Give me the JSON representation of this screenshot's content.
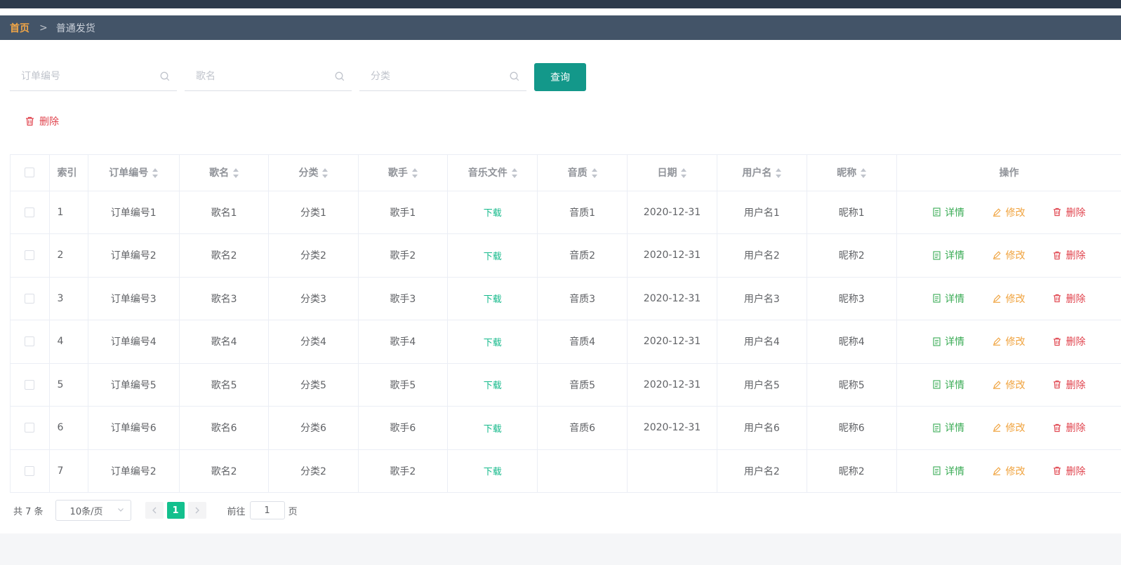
{
  "breadcrumb": {
    "home": "首页",
    "separator": ">",
    "current": "普通发货"
  },
  "search": {
    "order_placeholder": "订单编号",
    "song_placeholder": "歌名",
    "category_placeholder": "分类",
    "query_label": "查询"
  },
  "bulk_delete_label": "删除",
  "table": {
    "headers": {
      "index": "索引",
      "order": "订单编号",
      "song": "歌名",
      "category": "分类",
      "singer": "歌手",
      "file": "音乐文件",
      "quality": "音质",
      "date": "日期",
      "username": "用户名",
      "nickname": "昵称",
      "ops": "操作"
    },
    "actions": {
      "detail": "详情",
      "edit": "修改",
      "delete": "删除"
    },
    "rows": [
      {
        "index": "1",
        "order": "订单编号1",
        "song": "歌名1",
        "category": "分类1",
        "singer": "歌手1",
        "file": "下载",
        "quality": "音质1",
        "date": "2020-12-31",
        "username": "用户名1",
        "nickname": "昵称1"
      },
      {
        "index": "2",
        "order": "订单编号2",
        "song": "歌名2",
        "category": "分类2",
        "singer": "歌手2",
        "file": "下载",
        "quality": "音质2",
        "date": "2020-12-31",
        "username": "用户名2",
        "nickname": "昵称2"
      },
      {
        "index": "3",
        "order": "订单编号3",
        "song": "歌名3",
        "category": "分类3",
        "singer": "歌手3",
        "file": "下载",
        "quality": "音质3",
        "date": "2020-12-31",
        "username": "用户名3",
        "nickname": "昵称3"
      },
      {
        "index": "4",
        "order": "订单编号4",
        "song": "歌名4",
        "category": "分类4",
        "singer": "歌手4",
        "file": "下载",
        "quality": "音质4",
        "date": "2020-12-31",
        "username": "用户名4",
        "nickname": "昵称4"
      },
      {
        "index": "5",
        "order": "订单编号5",
        "song": "歌名5",
        "category": "分类5",
        "singer": "歌手5",
        "file": "下载",
        "quality": "音质5",
        "date": "2020-12-31",
        "username": "用户名5",
        "nickname": "昵称5"
      },
      {
        "index": "6",
        "order": "订单编号6",
        "song": "歌名6",
        "category": "分类6",
        "singer": "歌手6",
        "file": "下载",
        "quality": "音质6",
        "date": "2020-12-31",
        "username": "用户名6",
        "nickname": "昵称6"
      },
      {
        "index": "7",
        "order": "订单编号2",
        "song": "歌名2",
        "category": "分类2",
        "singer": "歌手2",
        "file": "下载",
        "quality": "",
        "date": "",
        "username": "用户名2",
        "nickname": "昵称2"
      }
    ]
  },
  "pagination": {
    "total": "共 7 条",
    "page_size": "10条/页",
    "current_page": "1",
    "goto_label": "前往",
    "goto_value": "1",
    "page_suffix": "页"
  },
  "colors": {
    "breadcrumb_bg": "#435468",
    "home_link": "#f0a546",
    "query_button": "#13988a",
    "active_page": "#13c08d",
    "delete": "#e0434d",
    "edit": "#f0a23c",
    "detail": "#3aab55",
    "download": "#13b98a"
  },
  "icons": {
    "search": "search-icon",
    "delete": "trash-icon",
    "detail": "document-icon",
    "edit": "pencil-icon",
    "prev": "chevron-left-icon",
    "next": "chevron-right-icon",
    "dropdown": "chevron-down-icon"
  }
}
